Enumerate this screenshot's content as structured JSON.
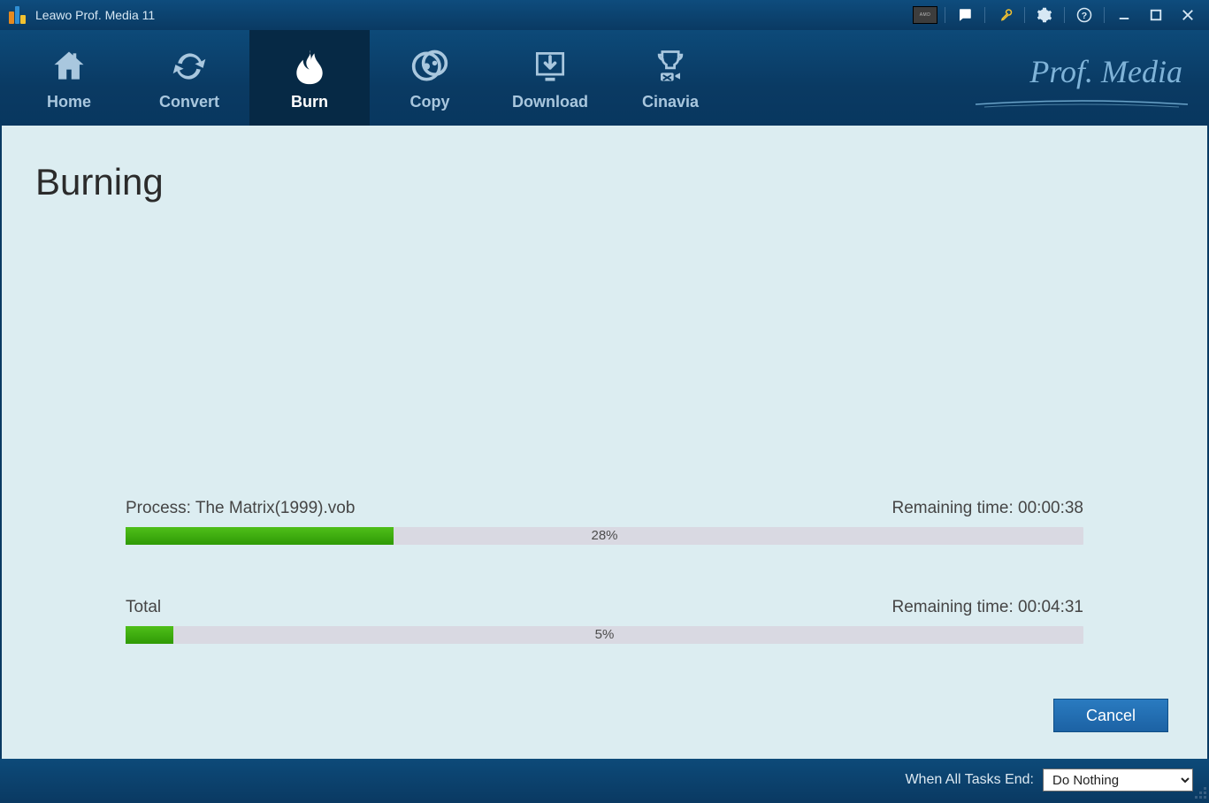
{
  "app": {
    "title": "Leawo Prof. Media 11",
    "brand_script": "Prof. Media"
  },
  "titlebar_buttons": {
    "amd": "AMD",
    "chat": "chat",
    "key": "register",
    "gear": "settings",
    "help": "help",
    "min": "minimize",
    "max": "maximize",
    "close": "close"
  },
  "nav": {
    "items": [
      {
        "id": "home",
        "label": "Home"
      },
      {
        "id": "convert",
        "label": "Convert"
      },
      {
        "id": "burn",
        "label": "Burn",
        "active": true
      },
      {
        "id": "copy",
        "label": "Copy"
      },
      {
        "id": "download",
        "label": "Download"
      },
      {
        "id": "cinavia",
        "label": "Cinavia"
      }
    ]
  },
  "page": {
    "title": "Burning",
    "process": {
      "label": "Process: The Matrix(1999).vob",
      "remaining_label": "Remaining time: 00:00:38",
      "percent_text": "28%",
      "percent": 28
    },
    "total": {
      "label": "Total",
      "remaining_label": "Remaining time: 00:04:31",
      "percent_text": "5%",
      "percent": 5
    },
    "cancel": "Cancel"
  },
  "footer": {
    "label": "When All Tasks End:",
    "selected": "Do Nothing"
  }
}
